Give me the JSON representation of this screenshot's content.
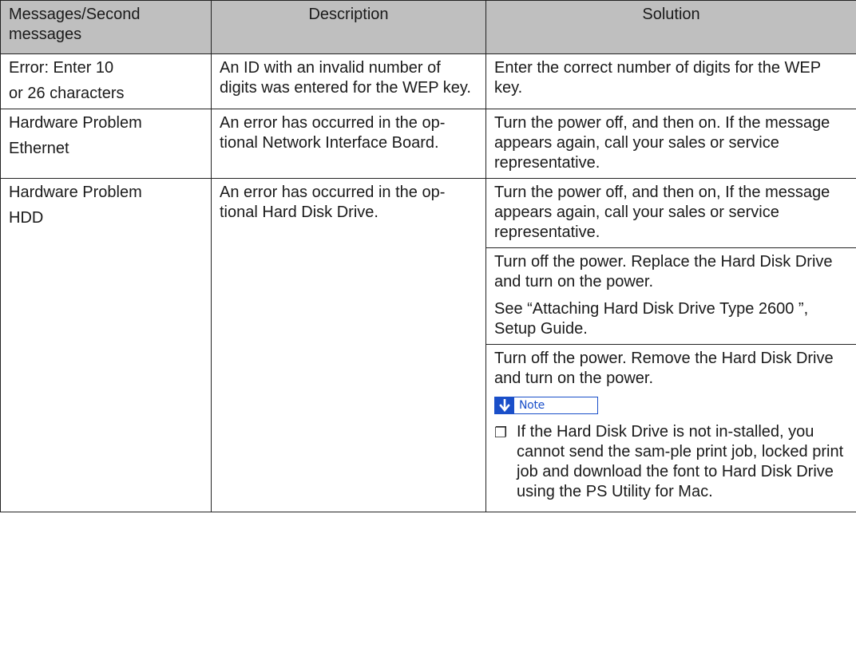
{
  "headers": {
    "messages": "Messages/Second messages",
    "description": "Description",
    "solution": "Solution"
  },
  "rows": [
    {
      "message_lines": [
        "Error: Enter 10",
        "or 26 characters"
      ],
      "description": "An ID with an invalid number of digits was entered for the WEP key.",
      "solutions": [
        "Enter the correct number of digits for the WEP key."
      ]
    },
    {
      "message_lines": [
        "Hardware Problem",
        "Ethernet"
      ],
      "description": "An error has occurred in the op-tional Network Interface Board.",
      "solutions": [
        "Turn the power off, and then on. If the message appears again, call your sales or service representative."
      ]
    },
    {
      "message_lines": [
        "Hardware Problem",
        "HDD"
      ],
      "description": "An error has occurred in the op-tional Hard Disk Drive.",
      "solutions": [
        "Turn the power off, and then on, If the message appears again, call your sales or service representative.",
        "Turn off the power. Replace the Hard Disk Drive and turn on the power.",
        "See “Attaching Hard Disk Drive Type 2600 ”, Setup Guide.",
        "Turn off the power. Remove the Hard Disk Drive and turn on the power."
      ],
      "note": {
        "label": "Note",
        "icon": "down-arrow-icon",
        "bullet_icon": "checkbox-icon",
        "text": "If the Hard Disk Drive is not in-stalled, you cannot send the sam-ple print job, locked print job and download the font to Hard Disk Drive using the PS Utility for Mac."
      }
    }
  ],
  "colors": {
    "header_bg": "#bfbfbf",
    "note_blue": "#1a4fc9",
    "border": "#222222"
  }
}
